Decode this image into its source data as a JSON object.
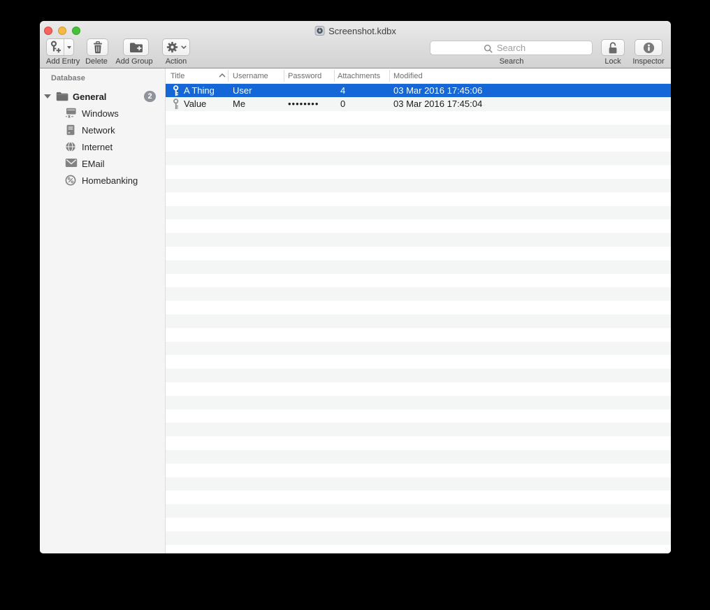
{
  "window": {
    "title": "Screenshot.kdbx"
  },
  "toolbar": {
    "add_entry_label": "Add Entry",
    "delete_label": "Delete",
    "add_group_label": "Add Group",
    "action_label": "Action",
    "search_placeholder": "Search",
    "search_label": "Search",
    "lock_label": "Lock",
    "inspector_label": "Inspector"
  },
  "sidebar": {
    "section_header": "Database",
    "root_group": {
      "label": "General",
      "badge_count": "2",
      "expanded": true
    },
    "groups": [
      {
        "label": "Windows",
        "icon": "windows-network-icon"
      },
      {
        "label": "Network",
        "icon": "server-icon"
      },
      {
        "label": "Internet",
        "icon": "globe-icon"
      },
      {
        "label": "EMail",
        "icon": "envelope-icon"
      },
      {
        "label": "Homebanking",
        "icon": "percent-icon"
      }
    ]
  },
  "table": {
    "columns": [
      "Title",
      "Username",
      "Password",
      "Attachments",
      "Modified"
    ],
    "sorted_by": "Title",
    "sort_direction": "ascending",
    "rows": [
      {
        "title": "A Thing",
        "username": "User",
        "password": "",
        "attachments": "4",
        "modified": "03 Mar 2016 17:45:06",
        "selected": true
      },
      {
        "title": "Value",
        "username": "Me",
        "password": "••••••••",
        "attachments": "0",
        "modified": "03 Mar 2016 17:45:04",
        "selected": false
      }
    ]
  },
  "icons": {
    "toolbar": [
      "key-plus-icon",
      "dropdown-arrow-icon",
      "trash-icon",
      "folder-plus-icon",
      "gear-icon",
      "chevron-down-icon",
      "search-icon",
      "open-padlock-icon",
      "info-icon"
    ],
    "titlebar": [
      "document-icon"
    ],
    "sidebar": [
      "disclosure-triangle-icon",
      "folder-icon",
      "windows-network-icon",
      "server-icon",
      "globe-icon",
      "envelope-icon",
      "percent-icon"
    ],
    "table": [
      "sort-ascending-icon",
      "key-icon"
    ]
  },
  "colors": {
    "selection_blue": "#1566d6",
    "row_stripe": "#f4f5f5",
    "sidebar_background": "#f5f5f6",
    "badge_gray": "#8f939b",
    "traffic_red": "#f4645c",
    "traffic_yellow": "#f6b843",
    "traffic_green": "#48c03c"
  }
}
